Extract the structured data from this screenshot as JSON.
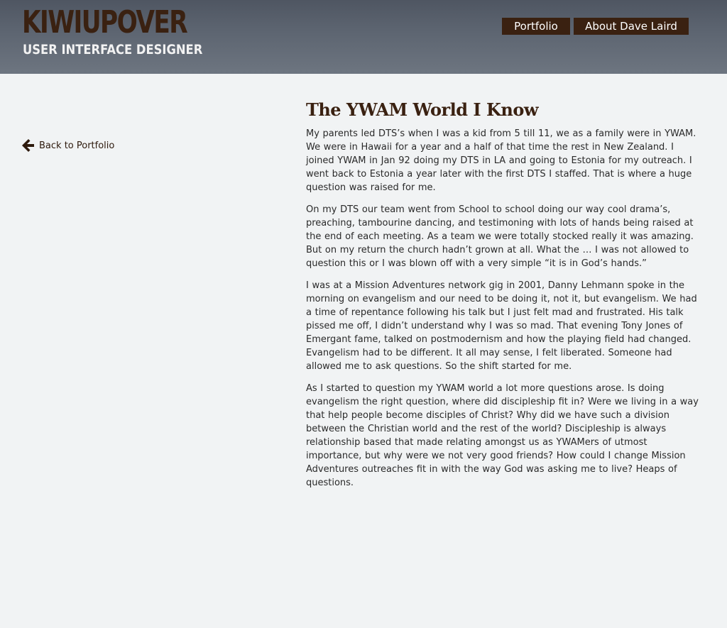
{
  "brand": {
    "title": "KIWIUPOVER",
    "subtitle": "USER INTERFACE DESIGNER"
  },
  "nav": {
    "portfolio": "Portfolio",
    "about": "About Dave Laird"
  },
  "back": {
    "label": "Back to Portfolio",
    "icon": "arrow-left-icon"
  },
  "article": {
    "title": "The YWAM World I Know",
    "paragraphs": [
      "My parents led DTS’s when I was a kid from 5 till 11, we as a family were in YWAM. We were in Hawaii for a year and a half of that time the rest in New Zealand. I joined YWAM in Jan 92 doing my DTS in LA and going to Estonia for my outreach. I went back to Estonia a year later with the first DTS I staffed. That is where a huge question was raised for me.",
      "On my DTS our team went from School to school doing our way cool drama’s, preaching, tambourine dancing, and testimoning with lots of hands being raised at the end of each meeting. As a team we were totally stocked really it was amazing. But on my return the church hadn’t grown at all. What the … I was not allowed to question this or I was blown off with a very simple “it is in God’s hands.”",
      "I was at a Mission Adventures network gig in 2001, Danny Lehmann spoke in the morning on evangelism and our need to be doing it, not it, but evangelism. We had a time of repentance following his talk but I just felt mad and frustrated. His talk pissed me off, I didn’t understand why I was so mad. That evening Tony Jones of Emergant fame, talked on postmodernism and how the playing field had changed. Evangelism had to be different. It all may sense, I felt liberated. Someone had allowed me to ask questions. So the shift started for me.",
      "As I started to question my YWAM world a lot more questions arose. Is doing evangelism the right question, where did discipleship fit in? Were we living in a way that help people become disciples of Christ? Why did we have such a division between the Christian world and the rest of the world? Discipleship is always relationship based that made relating amongst us as YWAMers of utmost importance, but why were we not very good friends? How could I change Mission Adventures outreaches fit in with the way God was asking me to live? Heaps of questions."
    ]
  },
  "colors": {
    "brand_brown": "#3a2111",
    "header_gray": "#5c6470",
    "page_bg": "#f1f3f4"
  }
}
